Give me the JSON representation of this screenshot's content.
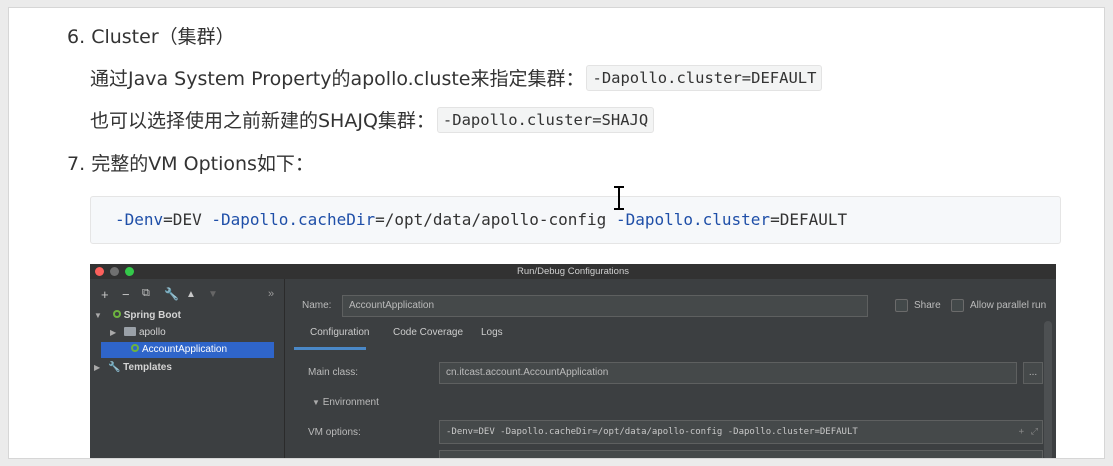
{
  "items": [
    {
      "number": "6.",
      "title": "Cluster（集群）"
    },
    {
      "number": "7.",
      "title": "完整的VM Options如下："
    }
  ],
  "paragraphs": {
    "p1_text": "通过Java System Property的apollo.cluste来指定集群：",
    "p1_code": "-Dapollo.cluster=DEFAULT",
    "p2_text": "也可以选择使用之前新建的SHAJQ集群：",
    "p2_code": "-Dapollo.cluster=SHAJQ"
  },
  "code_block": {
    "flag1": "-Denv",
    "eq1": "=DEV ",
    "flag2": "-Dapollo.cacheDir",
    "eq2": "=/opt/data/apollo-config ",
    "flag3": "-Dapollo.cluster",
    "eq3": "=DEFAULT"
  },
  "ide": {
    "window_title": "Run/Debug Configurations",
    "toolbar_more": "»",
    "tree": {
      "spring_boot": "Spring Boot",
      "apollo": "apollo",
      "account_app": "AccountApplication",
      "templates": "Templates"
    },
    "name_label": "Name:",
    "name_value": "AccountApplication",
    "share_label": "Share",
    "allow_parallel_label": "Allow parallel run",
    "tabs": [
      "Configuration",
      "Code Coverage",
      "Logs"
    ],
    "main_class_label": "Main class:",
    "main_class_value": "cn.itcast.account.AccountApplication",
    "browse_label": "...",
    "environment_label": "Environment",
    "vm_options_label": "VM options:",
    "vm_options_value": "-Denv=DEV -Dapollo.cacheDir=/opt/data/apollo-config -Dapollo.cluster=DEFAULT"
  },
  "colors": {
    "code_flag": "#1f4fa8",
    "selection": "#2f65ca",
    "tab_underline": "#4a88c7"
  }
}
